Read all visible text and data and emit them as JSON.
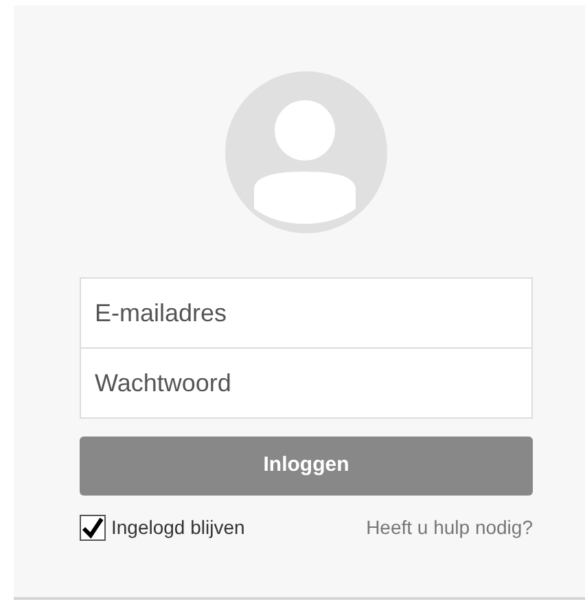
{
  "login": {
    "email": {
      "placeholder": "E-mailadres"
    },
    "password": {
      "placeholder": "Wachtwoord"
    },
    "submit": "Inloggen",
    "remember": {
      "label": "Ingelogd blijven",
      "checked": true
    },
    "help_link": "Heeft u hulp nodig?"
  }
}
